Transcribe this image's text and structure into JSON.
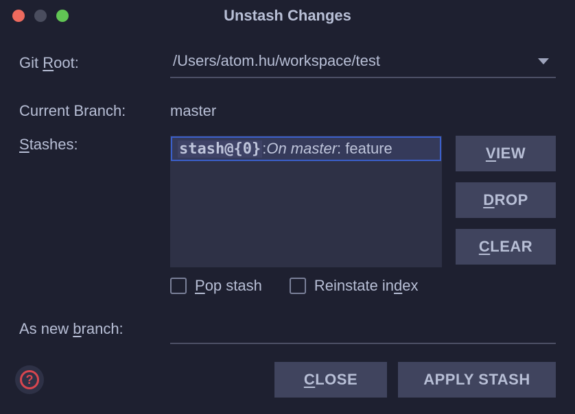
{
  "title": "Unstash Changes",
  "labels": {
    "git_root_pre": "Git ",
    "git_root_hot": "R",
    "git_root_post": "oot:",
    "current_branch": "Current Branch:",
    "stashes_hot": "S",
    "stashes_post": "tashes:",
    "pop_pre": "",
    "pop_hot": "P",
    "pop_post": "op stash",
    "reinstate_pre": "Reinstate in",
    "reinstate_hot": "d",
    "reinstate_post": "ex",
    "new_branch_pre": "As new ",
    "new_branch_hot": "b",
    "new_branch_post": "ranch:"
  },
  "git_root": "/Users/atom.hu/workspace/test",
  "current_branch": "master",
  "stashes": [
    {
      "id": "stash@{0}",
      "sep": ": ",
      "branch_prefix": "On master",
      "tail": ": feature"
    }
  ],
  "buttons": {
    "view_hot": "V",
    "view_post": "IEW",
    "drop_hot": "D",
    "drop_post": "ROP",
    "clear_hot": "C",
    "clear_post": "LEAR",
    "close_hot": "C",
    "close_post": "LOSE",
    "apply": "APPLY STASH"
  },
  "help_glyph": "?"
}
